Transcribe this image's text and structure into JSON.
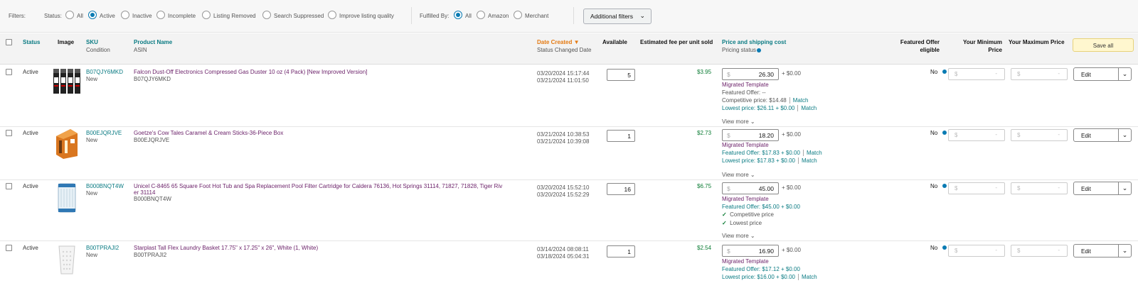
{
  "filters": {
    "label": "Filters:",
    "status_label": "Status:",
    "status_options": [
      "All",
      "Active",
      "Inactive",
      "Incomplete",
      "Listing Removed",
      "Search Suppressed",
      "Improve listing quality"
    ],
    "fulfilled_label": "Fulfilled By:",
    "fulfilled_options": [
      "All",
      "Amazon",
      "Merchant"
    ],
    "additional_filters": "Additional filters"
  },
  "columns": {
    "status": "Status",
    "image": "Image",
    "sku": "SKU",
    "condition": "Condition",
    "product_name": "Product Name",
    "asin": "ASIN",
    "date_created": "Date Created",
    "status_changed": "Status Changed Date",
    "available": "Available",
    "fee": "Estimated fee per unit sold",
    "price": "Price and shipping cost",
    "pricing_status": "Pricing status",
    "featured_offer": "Featured Offer",
    "eligible": "eligible",
    "min_price": "Your Minimum",
    "min_price2": "Price",
    "max_price": "Your Maximum Price",
    "save_all": "Save all"
  },
  "rows": [
    {
      "status": "Active",
      "sku": "B07QJY6MKD",
      "condition": "New",
      "name": "Falcon Dust-Off Electronics Compressed Gas Duster 10 oz (4 Pack) [New Improved Version]",
      "asin": "B07QJY6MKD",
      "date_created": "03/20/2024 15:17:44",
      "status_changed": "03/21/2024 11:01:50",
      "available": "5",
      "fee": "$3.95",
      "currency": "$",
      "price": "26.30",
      "shipping": "+ $0.00",
      "template": "Migrated Template",
      "line1": "Featured Offer: --",
      "line2": "Competitive price: $14.48",
      "line2_action": "Match",
      "line3": "Lowest price: $26.11 + $0.00",
      "line3_action": "Match",
      "view_more": "View more",
      "featured": "No",
      "min": "-",
      "max": "-",
      "edit": "Edit"
    },
    {
      "status": "Active",
      "sku": "B00EJQRJVE",
      "condition": "New",
      "name": "Goetze's Cow Tales Caramel & Cream Sticks-36-Piece Box",
      "asin": "B00EJQRJVE",
      "date_created": "03/21/2024 10:38:53",
      "status_changed": "03/21/2024 10:39:08",
      "available": "1",
      "fee": "$2.73",
      "currency": "$",
      "price": "18.20",
      "shipping": "+ $0.00",
      "template": "Migrated Template",
      "line1": "Featured Offer: $17.83 + $0.00",
      "line1_action": "Match",
      "line2": "Lowest price: $17.83 + $0.00",
      "line2_action": "Match",
      "view_more": "View more",
      "featured": "No",
      "min": "-",
      "max": "-",
      "edit": "Edit"
    },
    {
      "status": "Active",
      "sku": "B000BNQT4W",
      "condition": "New",
      "name_line1": "Unicel C-8465 65 Square Foot Hot Tub and Spa Replacement Pool Filter Cartridge for Caldera 76136, Hot Springs 31114, 71827, 71828, Tiger Riv",
      "name_line2": "er 31114",
      "asin": "B000BNQT4W",
      "date_created": "03/20/2024 15:52:10",
      "status_changed": "03/20/2024 15:52:29",
      "available": "16",
      "fee": "$6.75",
      "currency": "$",
      "price": "45.00",
      "shipping": "+ $0.00",
      "template": "Migrated Template",
      "line1": "Featured Offer: $45.00 + $0.00",
      "check1": "Competitive price",
      "check2": "Lowest price",
      "view_more": "View more",
      "featured": "No",
      "min": "-",
      "max": "-",
      "edit": "Edit"
    },
    {
      "status": "Active",
      "sku": "B00TPRAJI2",
      "condition": "New",
      "name": "Starplast Tall Flex Laundry Basket 17.75\" x 17.25\" x 26\", White (1, White)",
      "asin": "B00TPRAJI2",
      "date_created": "03/14/2024 08:08:11",
      "status_changed": "03/18/2024 05:04:31",
      "available": "1",
      "fee": "$2.54",
      "currency": "$",
      "price": "16.90",
      "shipping": "+ $0.00",
      "template": "Migrated Template",
      "line1": "Featured Offer: $17.12 + $0.00",
      "line2": "Lowest price: $16.00 + $0.00",
      "line2_action": "Match",
      "featured": "No",
      "min": "-",
      "max": "-",
      "edit": "Edit"
    }
  ]
}
